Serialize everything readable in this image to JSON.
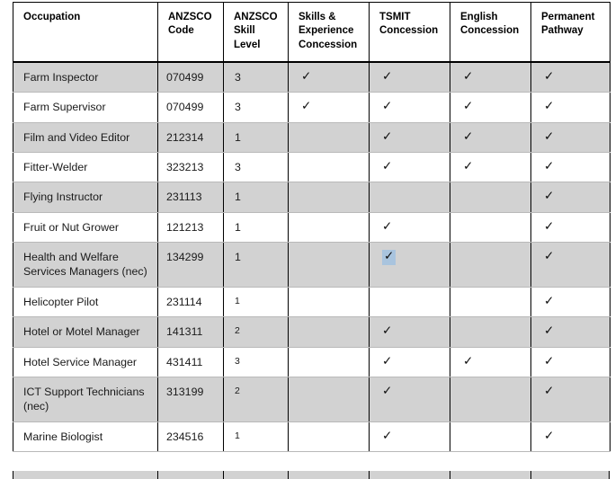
{
  "table": {
    "columns": [
      {
        "key": "occupation",
        "label": "Occupation"
      },
      {
        "key": "code",
        "label": "ANZSCO\nCode"
      },
      {
        "key": "skill",
        "label": "ANZSCO\nSkill\nLevel"
      },
      {
        "key": "skills_concession",
        "label": "Skills &\nExperience\nConcession"
      },
      {
        "key": "tsmit_concession",
        "label": "TSMIT\nConcession"
      },
      {
        "key": "english_concession",
        "label": "English\nConcession"
      },
      {
        "key": "permanent_pathway",
        "label": "Permanent\nPathway"
      }
    ],
    "tick_glyph": "✓",
    "rows": [
      {
        "occupation": "Farm Inspector",
        "code": "070499",
        "skill": "3",
        "skills_concession": "✓",
        "tsmit_concession": "✓",
        "english_concession": "✓",
        "permanent_pathway": "✓"
      },
      {
        "occupation": "Farm Supervisor",
        "code": "070499",
        "skill": "3",
        "skills_concession": "✓",
        "tsmit_concession": "✓",
        "english_concession": "✓",
        "permanent_pathway": "✓"
      },
      {
        "occupation": "Film and Video Editor",
        "code": "212314",
        "skill": "1",
        "skills_concession": "",
        "tsmit_concession": "✓",
        "english_concession": "✓",
        "permanent_pathway": "✓"
      },
      {
        "occupation": "Fitter-Welder",
        "code": "323213",
        "skill": "3",
        "skills_concession": "",
        "tsmit_concession": "✓",
        "english_concession": "✓",
        "permanent_pathway": "✓"
      },
      {
        "occupation": "Flying Instructor",
        "code": "231113",
        "skill": "1",
        "skills_concession": "",
        "tsmit_concession": "",
        "english_concession": "",
        "permanent_pathway": "✓"
      },
      {
        "occupation": "Fruit or Nut Grower",
        "code": "121213",
        "skill": "1",
        "skills_concession": "",
        "tsmit_concession": "✓",
        "english_concession": "",
        "permanent_pathway": "✓"
      },
      {
        "occupation": "Health and Welfare Services Managers (nec)",
        "code": "134299",
        "skill": "1",
        "skills_concession": "",
        "tsmit_concession": "✓",
        "english_concession": "",
        "permanent_pathway": "✓"
      },
      {
        "occupation": "Helicopter Pilot",
        "code": "231114",
        "skill": "1",
        "skills_concession": "",
        "tsmit_concession": "",
        "english_concession": "",
        "permanent_pathway": "✓"
      },
      {
        "occupation": "Hotel or Motel Manager",
        "code": "141311",
        "skill": "2",
        "skills_concession": "",
        "tsmit_concession": "✓",
        "english_concession": "",
        "permanent_pathway": "✓"
      },
      {
        "occupation": "Hotel Service Manager",
        "code": "431411",
        "skill": "3",
        "skills_concession": "",
        "tsmit_concession": "✓",
        "english_concession": "✓",
        "permanent_pathway": "✓"
      },
      {
        "occupation": "ICT Support Technicians (nec)",
        "code": "313199",
        "skill": "2",
        "skills_concession": "",
        "tsmit_concession": "✓",
        "english_concession": "",
        "permanent_pathway": "✓"
      },
      {
        "occupation": "Marine Biologist",
        "code": "234516",
        "skill": "1",
        "skills_concession": "",
        "tsmit_concession": "✓",
        "english_concession": "",
        "permanent_pathway": "✓"
      }
    ],
    "selection": {
      "row_index": 6,
      "column_key": "tsmit_concession",
      "highlight_color": "#a9c4de"
    },
    "styling": {
      "shaded_row_color": "#d2d2d2",
      "plain_row_color": "#ffffff",
      "border_color": "#000000",
      "text_color": "#1a1a1a"
    }
  }
}
